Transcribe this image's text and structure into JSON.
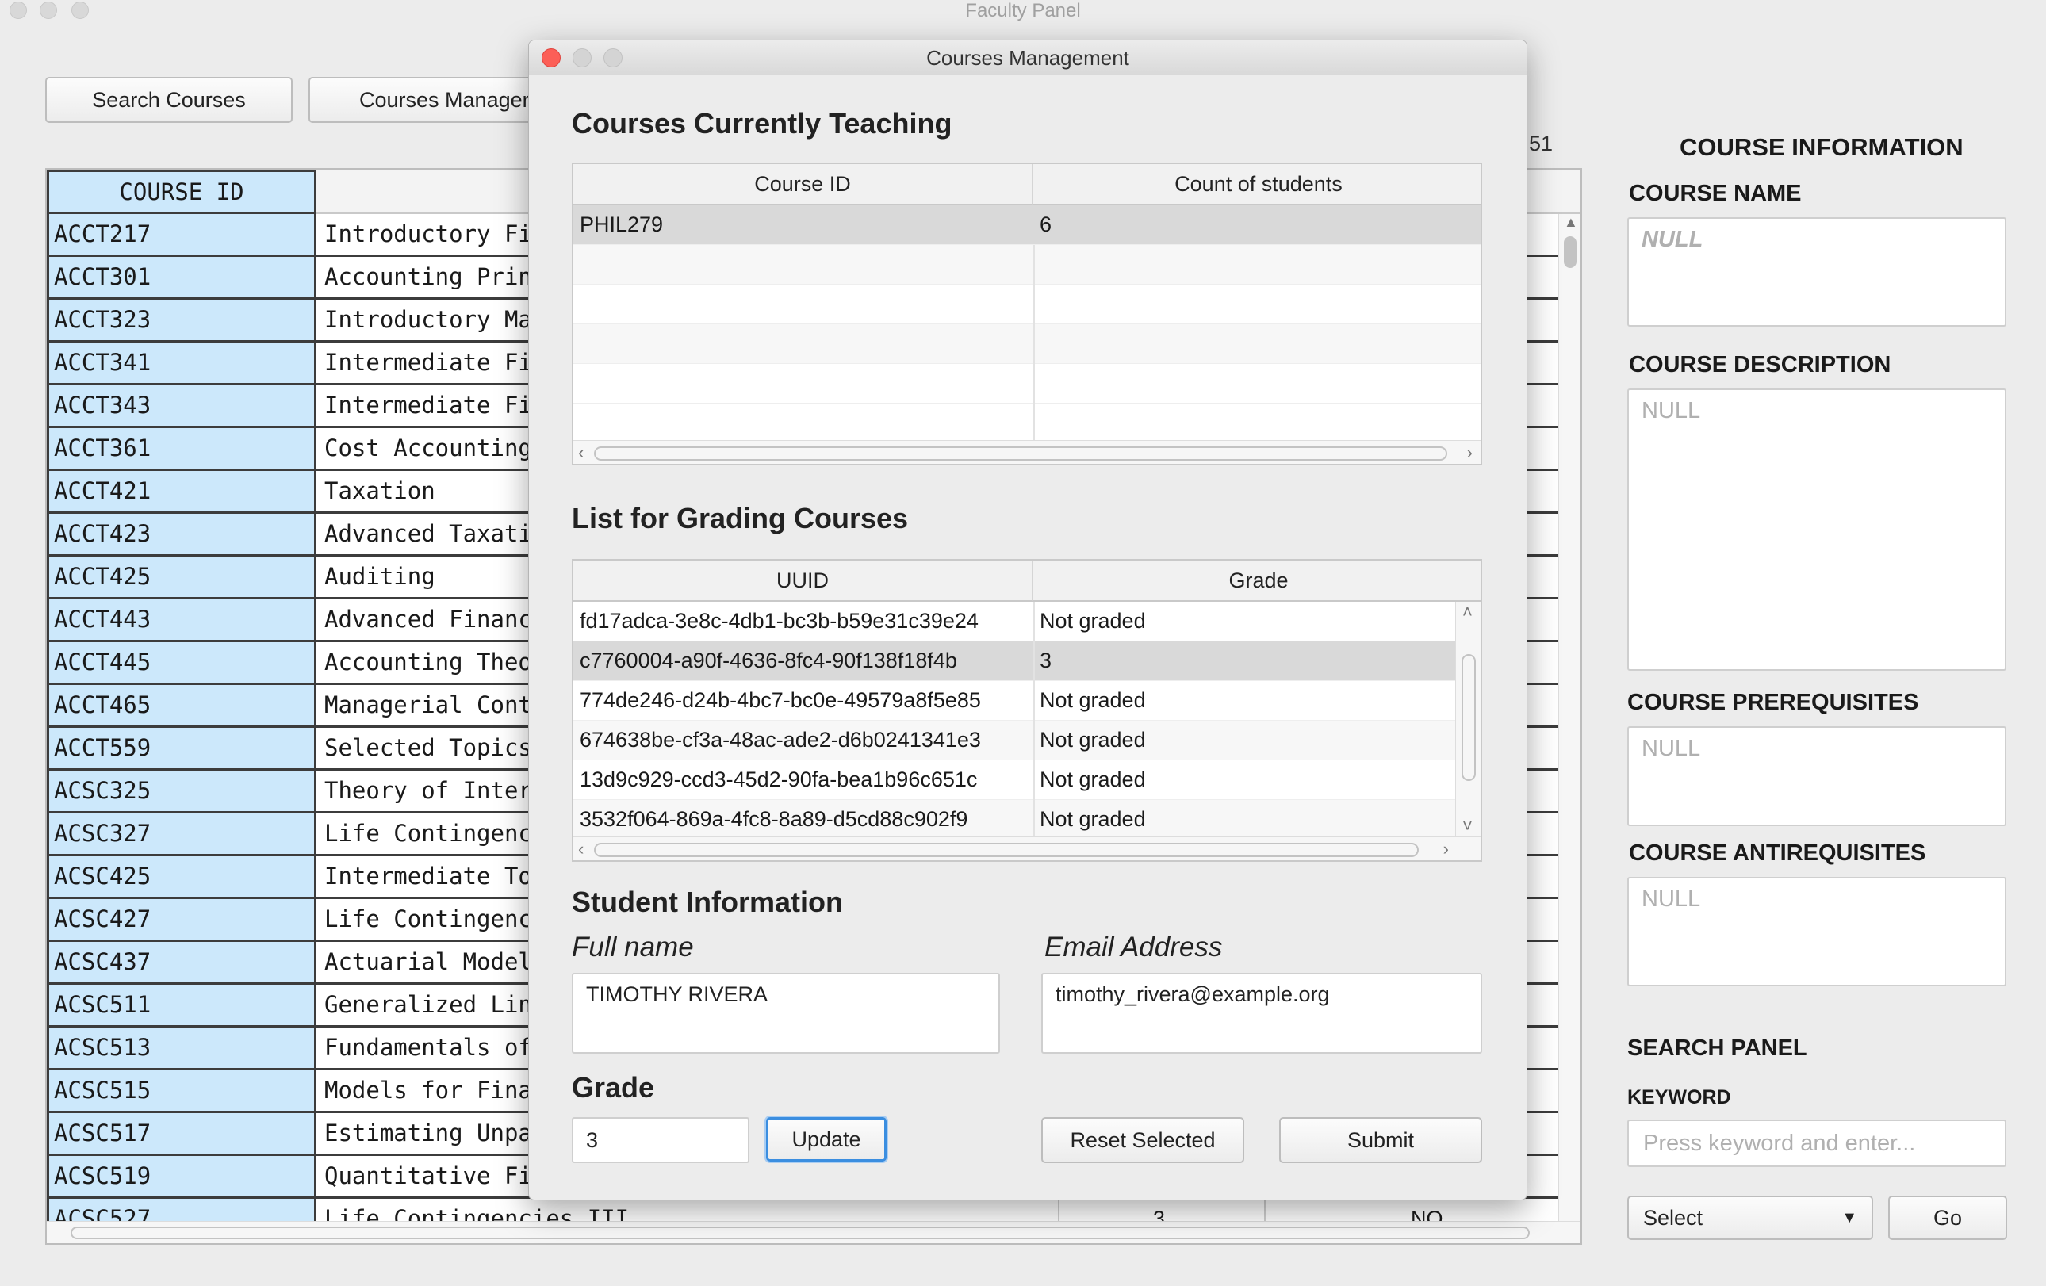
{
  "window": {
    "title": "Faculty Panel"
  },
  "toolbar": {
    "search_courses": "Search Courses",
    "courses_management": "Courses Management"
  },
  "partial_count": "51",
  "course_table": {
    "id_header": "COURSE ID",
    "rows": [
      {
        "id": "ACCT217",
        "name": "Introductory Financial Accounting"
      },
      {
        "id": "ACCT301",
        "name": "Accounting Principles"
      },
      {
        "id": "ACCT323",
        "name": "Introductory Managerial Accounting"
      },
      {
        "id": "ACCT341",
        "name": "Intermediate Financial Accounting I"
      },
      {
        "id": "ACCT343",
        "name": "Intermediate Financial Accounting II"
      },
      {
        "id": "ACCT361",
        "name": "Cost Accounting"
      },
      {
        "id": "ACCT421",
        "name": "Taxation"
      },
      {
        "id": "ACCT423",
        "name": "Advanced Taxation"
      },
      {
        "id": "ACCT425",
        "name": "Auditing"
      },
      {
        "id": "ACCT443",
        "name": "Advanced Financial Accounting"
      },
      {
        "id": "ACCT445",
        "name": "Accounting Theory"
      },
      {
        "id": "ACCT465",
        "name": "Managerial Control"
      },
      {
        "id": "ACCT559",
        "name": "Selected Topics"
      },
      {
        "id": "ACSC325",
        "name": "Theory of Interest"
      },
      {
        "id": "ACSC327",
        "name": "Life Contingencies"
      },
      {
        "id": "ACSC425",
        "name": "Intermediate Topics"
      },
      {
        "id": "ACSC427",
        "name": "Life Contingencies"
      },
      {
        "id": "ACSC437",
        "name": "Actuarial Models"
      },
      {
        "id": "ACSC511",
        "name": "Generalized Linear"
      },
      {
        "id": "ACSC513",
        "name": "Fundamentals of"
      },
      {
        "id": "ACSC515",
        "name": "Models for Financial"
      },
      {
        "id": "ACSC517",
        "name": "Estimating Unpaid"
      },
      {
        "id": "ACSC519",
        "name": "Quantitative Finance"
      },
      {
        "id": "ACSC527",
        "name": "Life Contingencies III",
        "credits": "3",
        "flag": "NO"
      }
    ]
  },
  "right_panel": {
    "heading": "COURSE INFORMATION",
    "course_name_label": "COURSE NAME",
    "course_name_value": "NULL",
    "course_description_label": "COURSE DESCRIPTION",
    "course_description_value": "NULL",
    "course_prerequisites_label": "COURSE PREREQUISITES",
    "course_prerequisites_value": "NULL",
    "course_antirequisites_label": "COURSE ANTIREQUISITES",
    "course_antirequisites_value": "NULL",
    "search_panel_label": "SEARCH PANEL",
    "keyword_label": "KEYWORD",
    "keyword_placeholder": "Press keyword and enter...",
    "select_label": "Select",
    "go_label": "Go"
  },
  "modal": {
    "title": "Courses Management",
    "teaching_heading": "Courses Currently Teaching",
    "teaching_columns": [
      "Course ID",
      "Count of students"
    ],
    "teaching_rows": [
      {
        "course_id": "PHIL279",
        "count": "6"
      }
    ],
    "grading_heading": "List for Grading Courses",
    "grading_columns": [
      "UUID",
      "Grade"
    ],
    "grading_rows": [
      {
        "uuid": "fd17adca-3e8c-4db1-bc3b-b59e31c39e24",
        "grade": "Not graded"
      },
      {
        "uuid": "c7760004-a90f-4636-8fc4-90f138f18f4b",
        "grade": "3"
      },
      {
        "uuid": "774de246-d24b-4bc7-bc0e-49579a8f5e85",
        "grade": "Not graded"
      },
      {
        "uuid": "674638be-cf3a-48ac-ade2-d6b0241341e3",
        "grade": "Not graded"
      },
      {
        "uuid": "13d9c929-ccd3-45d2-90fa-bea1b96c651c",
        "grade": "Not graded"
      },
      {
        "uuid": "3532f064-869a-4fc8-8a89-d5cd88c902f9",
        "grade": "Not graded"
      }
    ],
    "student_heading": "Student Information",
    "full_name_label": "Full name",
    "full_name_value": "TIMOTHY RIVERA",
    "email_label": "Email Address",
    "email_value": "timothy_rivera@example.org",
    "grade_heading": "Grade",
    "grade_value": "3",
    "update_label": "Update",
    "reset_label": "Reset Selected",
    "submit_label": "Submit"
  }
}
